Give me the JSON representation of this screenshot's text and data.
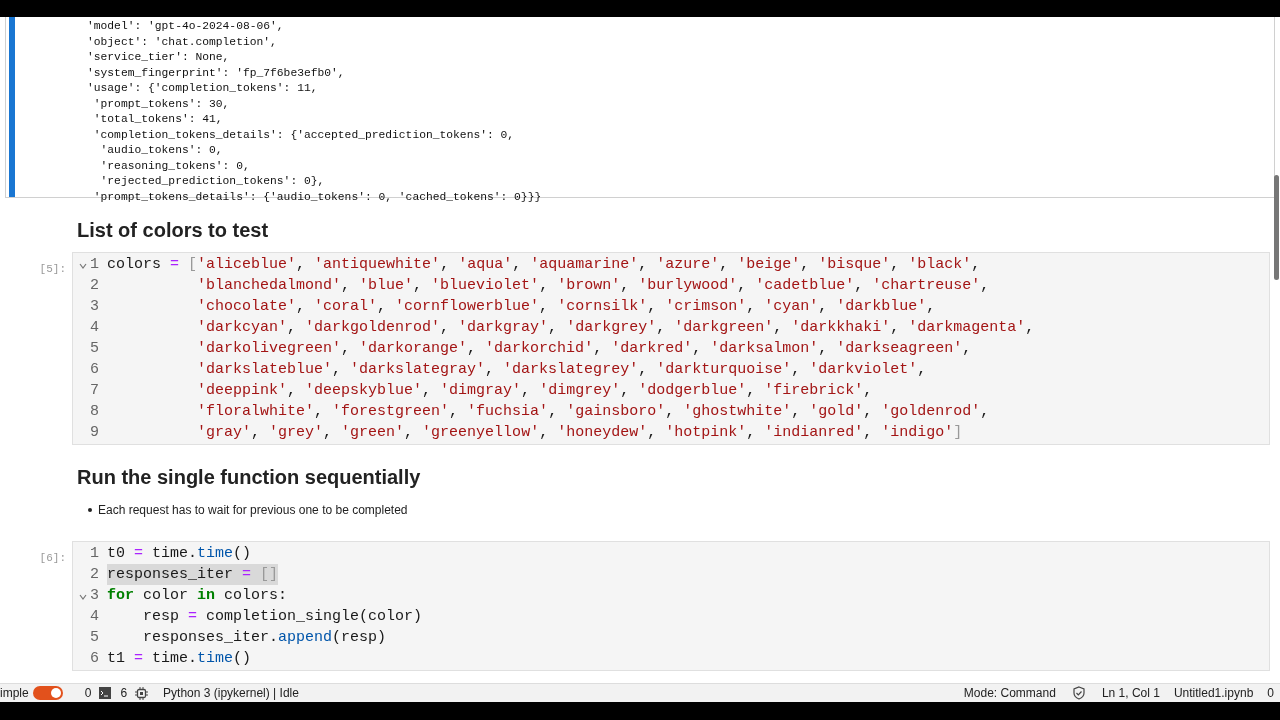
{
  "output_cell": {
    "lines": [
      "'model': 'gpt-4o-2024-08-06',",
      "'object': 'chat.completion',",
      "'service_tier': None,",
      "'system_fingerprint': 'fp_7f6be3efb0',",
      "'usage': {'completion_tokens': 11,",
      " 'prompt_tokens': 30,",
      " 'total_tokens': 41,",
      " 'completion_tokens_details': {'accepted_prediction_tokens': 0,",
      "  'audio_tokens': 0,",
      "  'reasoning_tokens': 0,",
      "  'rejected_prediction_tokens': 0},",
      " 'prompt_tokens_details': {'audio_tokens': 0, 'cached_tokens': 0}}}"
    ]
  },
  "cells": [
    {
      "kind": "markdown",
      "heading": "List of colors to test"
    },
    {
      "kind": "code",
      "prompt": "[5]:",
      "lines": [
        {
          "number": "1",
          "fold": true,
          "highlighted": false,
          "tokens": [
            {
              "kind": "plain",
              "text": "colors "
            },
            {
              "kind": "operator",
              "text": "= "
            },
            {
              "kind": "bracket",
              "text": "["
            },
            {
              "kind": "string",
              "text": "'aliceblue'"
            },
            {
              "kind": "plain",
              "text": ", "
            },
            {
              "kind": "string",
              "text": "'antiquewhite'"
            },
            {
              "kind": "plain",
              "text": ", "
            },
            {
              "kind": "string",
              "text": "'aqua'"
            },
            {
              "kind": "plain",
              "text": ", "
            },
            {
              "kind": "string",
              "text": "'aquamarine'"
            },
            {
              "kind": "plain",
              "text": ", "
            },
            {
              "kind": "string",
              "text": "'azure'"
            },
            {
              "kind": "plain",
              "text": ", "
            },
            {
              "kind": "string",
              "text": "'beige'"
            },
            {
              "kind": "plain",
              "text": ", "
            },
            {
              "kind": "string",
              "text": "'bisque'"
            },
            {
              "kind": "plain",
              "text": ", "
            },
            {
              "kind": "string",
              "text": "'black'"
            },
            {
              "kind": "plain",
              "text": ","
            }
          ]
        },
        {
          "number": "2",
          "fold": false,
          "highlighted": false,
          "tokens": [
            {
              "kind": "string",
              "text": "          'blanchedalmond'"
            },
            {
              "kind": "plain",
              "text": ", "
            },
            {
              "kind": "string",
              "text": "'blue'"
            },
            {
              "kind": "plain",
              "text": ", "
            },
            {
              "kind": "string",
              "text": "'blueviolet'"
            },
            {
              "kind": "plain",
              "text": ", "
            },
            {
              "kind": "string",
              "text": "'brown'"
            },
            {
              "kind": "plain",
              "text": ", "
            },
            {
              "kind": "string",
              "text": "'burlywood'"
            },
            {
              "kind": "plain",
              "text": ", "
            },
            {
              "kind": "string",
              "text": "'cadetblue'"
            },
            {
              "kind": "plain",
              "text": ", "
            },
            {
              "kind": "string",
              "text": "'chartreuse'"
            },
            {
              "kind": "plain",
              "text": ","
            }
          ]
        },
        {
          "number": "3",
          "fold": false,
          "highlighted": false,
          "tokens": [
            {
              "kind": "string",
              "text": "          'chocolate'"
            },
            {
              "kind": "plain",
              "text": ", "
            },
            {
              "kind": "string",
              "text": "'coral'"
            },
            {
              "kind": "plain",
              "text": ", "
            },
            {
              "kind": "string",
              "text": "'cornflowerblue'"
            },
            {
              "kind": "plain",
              "text": ", "
            },
            {
              "kind": "string",
              "text": "'cornsilk'"
            },
            {
              "kind": "plain",
              "text": ", "
            },
            {
              "kind": "string",
              "text": "'crimson'"
            },
            {
              "kind": "plain",
              "text": ", "
            },
            {
              "kind": "string",
              "text": "'cyan'"
            },
            {
              "kind": "plain",
              "text": ", "
            },
            {
              "kind": "string",
              "text": "'darkblue'"
            },
            {
              "kind": "plain",
              "text": ","
            }
          ]
        },
        {
          "number": "4",
          "fold": false,
          "highlighted": false,
          "tokens": [
            {
              "kind": "string",
              "text": "          'darkcyan'"
            },
            {
              "kind": "plain",
              "text": ", "
            },
            {
              "kind": "string",
              "text": "'darkgoldenrod'"
            },
            {
              "kind": "plain",
              "text": ", "
            },
            {
              "kind": "string",
              "text": "'darkgray'"
            },
            {
              "kind": "plain",
              "text": ", "
            },
            {
              "kind": "string",
              "text": "'darkgrey'"
            },
            {
              "kind": "plain",
              "text": ", "
            },
            {
              "kind": "string",
              "text": "'darkgreen'"
            },
            {
              "kind": "plain",
              "text": ", "
            },
            {
              "kind": "string",
              "text": "'darkkhaki'"
            },
            {
              "kind": "plain",
              "text": ", "
            },
            {
              "kind": "string",
              "text": "'darkmagenta'"
            },
            {
              "kind": "plain",
              "text": ","
            }
          ]
        },
        {
          "number": "5",
          "fold": false,
          "highlighted": false,
          "tokens": [
            {
              "kind": "string",
              "text": "          'darkolivegreen'"
            },
            {
              "kind": "plain",
              "text": ", "
            },
            {
              "kind": "string",
              "text": "'darkorange'"
            },
            {
              "kind": "plain",
              "text": ", "
            },
            {
              "kind": "string",
              "text": "'darkorchid'"
            },
            {
              "kind": "plain",
              "text": ", "
            },
            {
              "kind": "string",
              "text": "'darkred'"
            },
            {
              "kind": "plain",
              "text": ", "
            },
            {
              "kind": "string",
              "text": "'darksalmon'"
            },
            {
              "kind": "plain",
              "text": ", "
            },
            {
              "kind": "string",
              "text": "'darkseagreen'"
            },
            {
              "kind": "plain",
              "text": ","
            }
          ]
        },
        {
          "number": "6",
          "fold": false,
          "highlighted": false,
          "tokens": [
            {
              "kind": "string",
              "text": "          'darkslateblue'"
            },
            {
              "kind": "plain",
              "text": ", "
            },
            {
              "kind": "string",
              "text": "'darkslategray'"
            },
            {
              "kind": "plain",
              "text": ", "
            },
            {
              "kind": "string",
              "text": "'darkslategrey'"
            },
            {
              "kind": "plain",
              "text": ", "
            },
            {
              "kind": "string",
              "text": "'darkturquoise'"
            },
            {
              "kind": "plain",
              "text": ", "
            },
            {
              "kind": "string",
              "text": "'darkviolet'"
            },
            {
              "kind": "plain",
              "text": ","
            }
          ]
        },
        {
          "number": "7",
          "fold": false,
          "highlighted": false,
          "tokens": [
            {
              "kind": "string",
              "text": "          'deeppink'"
            },
            {
              "kind": "plain",
              "text": ", "
            },
            {
              "kind": "string",
              "text": "'deepskyblue'"
            },
            {
              "kind": "plain",
              "text": ", "
            },
            {
              "kind": "string",
              "text": "'dimgray'"
            },
            {
              "kind": "plain",
              "text": ", "
            },
            {
              "kind": "string",
              "text": "'dimgrey'"
            },
            {
              "kind": "plain",
              "text": ", "
            },
            {
              "kind": "string",
              "text": "'dodgerblue'"
            },
            {
              "kind": "plain",
              "text": ", "
            },
            {
              "kind": "string",
              "text": "'firebrick'"
            },
            {
              "kind": "plain",
              "text": ","
            }
          ]
        },
        {
          "number": "8",
          "fold": false,
          "highlighted": false,
          "tokens": [
            {
              "kind": "string",
              "text": "          'floralwhite'"
            },
            {
              "kind": "plain",
              "text": ", "
            },
            {
              "kind": "string",
              "text": "'forestgreen'"
            },
            {
              "kind": "plain",
              "text": ", "
            },
            {
              "kind": "string",
              "text": "'fuchsia'"
            },
            {
              "kind": "plain",
              "text": ", "
            },
            {
              "kind": "string",
              "text": "'gainsboro'"
            },
            {
              "kind": "plain",
              "text": ", "
            },
            {
              "kind": "string",
              "text": "'ghostwhite'"
            },
            {
              "kind": "plain",
              "text": ", "
            },
            {
              "kind": "string",
              "text": "'gold'"
            },
            {
              "kind": "plain",
              "text": ", "
            },
            {
              "kind": "string",
              "text": "'goldenrod'"
            },
            {
              "kind": "plain",
              "text": ","
            }
          ]
        },
        {
          "number": "9",
          "fold": false,
          "highlighted": false,
          "tokens": [
            {
              "kind": "string",
              "text": "          'gray'"
            },
            {
              "kind": "plain",
              "text": ", "
            },
            {
              "kind": "string",
              "text": "'grey'"
            },
            {
              "kind": "plain",
              "text": ", "
            },
            {
              "kind": "string",
              "text": "'green'"
            },
            {
              "kind": "plain",
              "text": ", "
            },
            {
              "kind": "string",
              "text": "'greenyellow'"
            },
            {
              "kind": "plain",
              "text": ", "
            },
            {
              "kind": "string",
              "text": "'honeydew'"
            },
            {
              "kind": "plain",
              "text": ", "
            },
            {
              "kind": "string",
              "text": "'hotpink'"
            },
            {
              "kind": "plain",
              "text": ", "
            },
            {
              "kind": "string",
              "text": "'indianred'"
            },
            {
              "kind": "plain",
              "text": ", "
            },
            {
              "kind": "string",
              "text": "'indigo'"
            },
            {
              "kind": "bracket",
              "text": "]"
            }
          ]
        }
      ]
    },
    {
      "kind": "markdown",
      "heading": "Run the single function sequentially",
      "bullets": [
        "Each request has to wait for previous one to be completed"
      ]
    },
    {
      "kind": "code",
      "prompt": "[6]:",
      "lines": [
        {
          "number": "1",
          "fold": false,
          "highlighted": false,
          "tokens": [
            {
              "kind": "plain",
              "text": "t0 "
            },
            {
              "kind": "operator",
              "text": "= "
            },
            {
              "kind": "plain",
              "text": "time."
            },
            {
              "kind": "function",
              "text": "time"
            },
            {
              "kind": "plain",
              "text": "()"
            }
          ]
        },
        {
          "number": "2",
          "fold": false,
          "highlighted": true,
          "tokens": [
            {
              "kind": "plain",
              "text": "responses_iter "
            },
            {
              "kind": "operator",
              "text": "= "
            },
            {
              "kind": "bracket",
              "text": "[]"
            }
          ]
        },
        {
          "number": "3",
          "fold": true,
          "highlighted": false,
          "tokens": [
            {
              "kind": "keyword",
              "text": "for"
            },
            {
              "kind": "plain",
              "text": " color "
            },
            {
              "kind": "keyword",
              "text": "in"
            },
            {
              "kind": "plain",
              "text": " colors:"
            }
          ]
        },
        {
          "number": "4",
          "fold": false,
          "highlighted": false,
          "tokens": [
            {
              "kind": "plain",
              "text": "    resp "
            },
            {
              "kind": "operator",
              "text": "= "
            },
            {
              "kind": "plain",
              "text": "completion_single(color)"
            }
          ]
        },
        {
          "number": "5",
          "fold": false,
          "highlighted": false,
          "tokens": [
            {
              "kind": "plain",
              "text": "    responses_iter."
            },
            {
              "kind": "function",
              "text": "append"
            },
            {
              "kind": "plain",
              "text": "(resp)"
            }
          ]
        },
        {
          "number": "6",
          "fold": false,
          "highlighted": false,
          "tokens": [
            {
              "kind": "plain",
              "text": "t1 "
            },
            {
              "kind": "operator",
              "text": "= "
            },
            {
              "kind": "plain",
              "text": "time."
            },
            {
              "kind": "function",
              "text": "time"
            },
            {
              "kind": "plain",
              "text": "()"
            }
          ]
        }
      ]
    }
  ],
  "status_bar": {
    "mode_label": "imple",
    "mode_toggle_on": true,
    "terminals": "0",
    "kernels": "6",
    "kernel_status": "Python 3 (ipykernel) | Idle",
    "mode": "Mode: Command",
    "cursor": "Ln 1, Col 1",
    "file": "Untitled1.ipynb",
    "count": "0"
  }
}
